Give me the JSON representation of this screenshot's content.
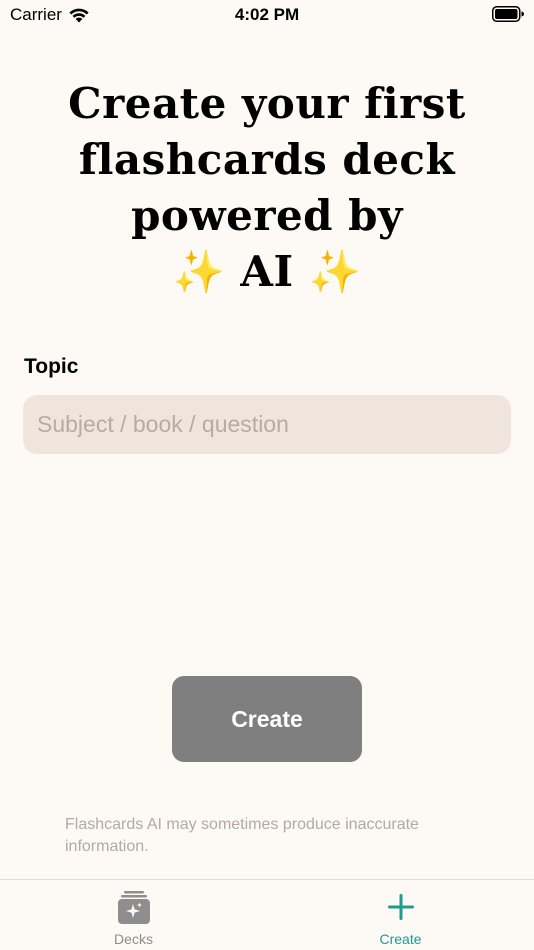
{
  "status_bar": {
    "carrier": "Carrier",
    "time": "4:02 PM"
  },
  "headline": {
    "line1": "Create your first",
    "line2": "flashcards deck",
    "line3": "powered by",
    "sparkle_left": "✨",
    "ai": "AI",
    "sparkle_right": "✨"
  },
  "form": {
    "topic_label": "Topic",
    "topic_placeholder": "Subject / book / question",
    "topic_value": ""
  },
  "create_button": {
    "label": "Create",
    "color": "#7f7f7f"
  },
  "disclaimer": "Flashcards AI may sometimes produce inaccurate information.",
  "tab_bar": {
    "tabs": [
      {
        "label": "Decks",
        "icon": "decks-icon",
        "active": false
      },
      {
        "label": "Create",
        "icon": "plus-icon",
        "active": true
      }
    ],
    "active_color": "#1f9b8f",
    "inactive_color": "#8e8e8e"
  }
}
